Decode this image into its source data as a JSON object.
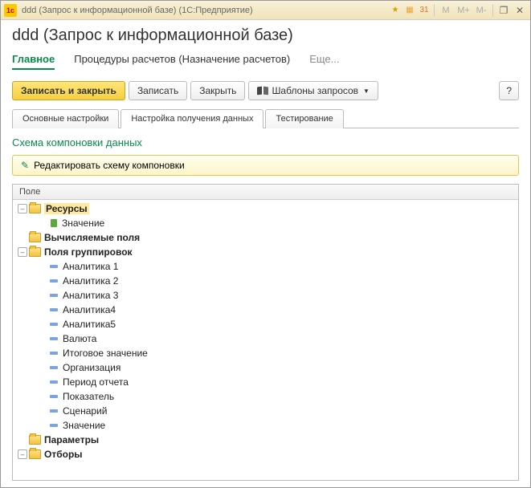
{
  "titlebar": {
    "title": "ddd (Запрос к информационной базе)  (1С:Предприятие)",
    "m_buttons": [
      "M",
      "M+",
      "M-"
    ]
  },
  "page": {
    "heading": "ddd (Запрос к информационной базе)"
  },
  "nav": {
    "main": "Главное",
    "proc": "Процедуры расчетов (Назначение расчетов)",
    "more": "Еще..."
  },
  "toolbar": {
    "save_close": "Записать и закрыть",
    "save": "Записать",
    "close": "Закрыть",
    "templates": "Шаблоны запросов",
    "help": "?"
  },
  "tabs": {
    "t1": "Основные настройки",
    "t2": "Настройка получения данных",
    "t3": "Тестирование"
  },
  "section": {
    "title": "Схема компоновки данных",
    "edit_btn": "Редактировать схему компоновки"
  },
  "grid": {
    "header": "Поле"
  },
  "tree": {
    "resources": "Ресурсы",
    "value": "Значение",
    "calc_fields": "Вычисляемые поля",
    "group_fields": "Поля группировок",
    "a1": "Аналитика 1",
    "a2": "Аналитика 2",
    "a3": "Аналитика 3",
    "a4": "Аналитика4",
    "a5": "Аналитика5",
    "currency": "Валюта",
    "total": "Итоговое значение",
    "org": "Организация",
    "period": "Период отчета",
    "indicator": "Показатель",
    "scenario": "Сценарий",
    "value2": "Значение",
    "params": "Параметры",
    "filters": "Отборы"
  }
}
